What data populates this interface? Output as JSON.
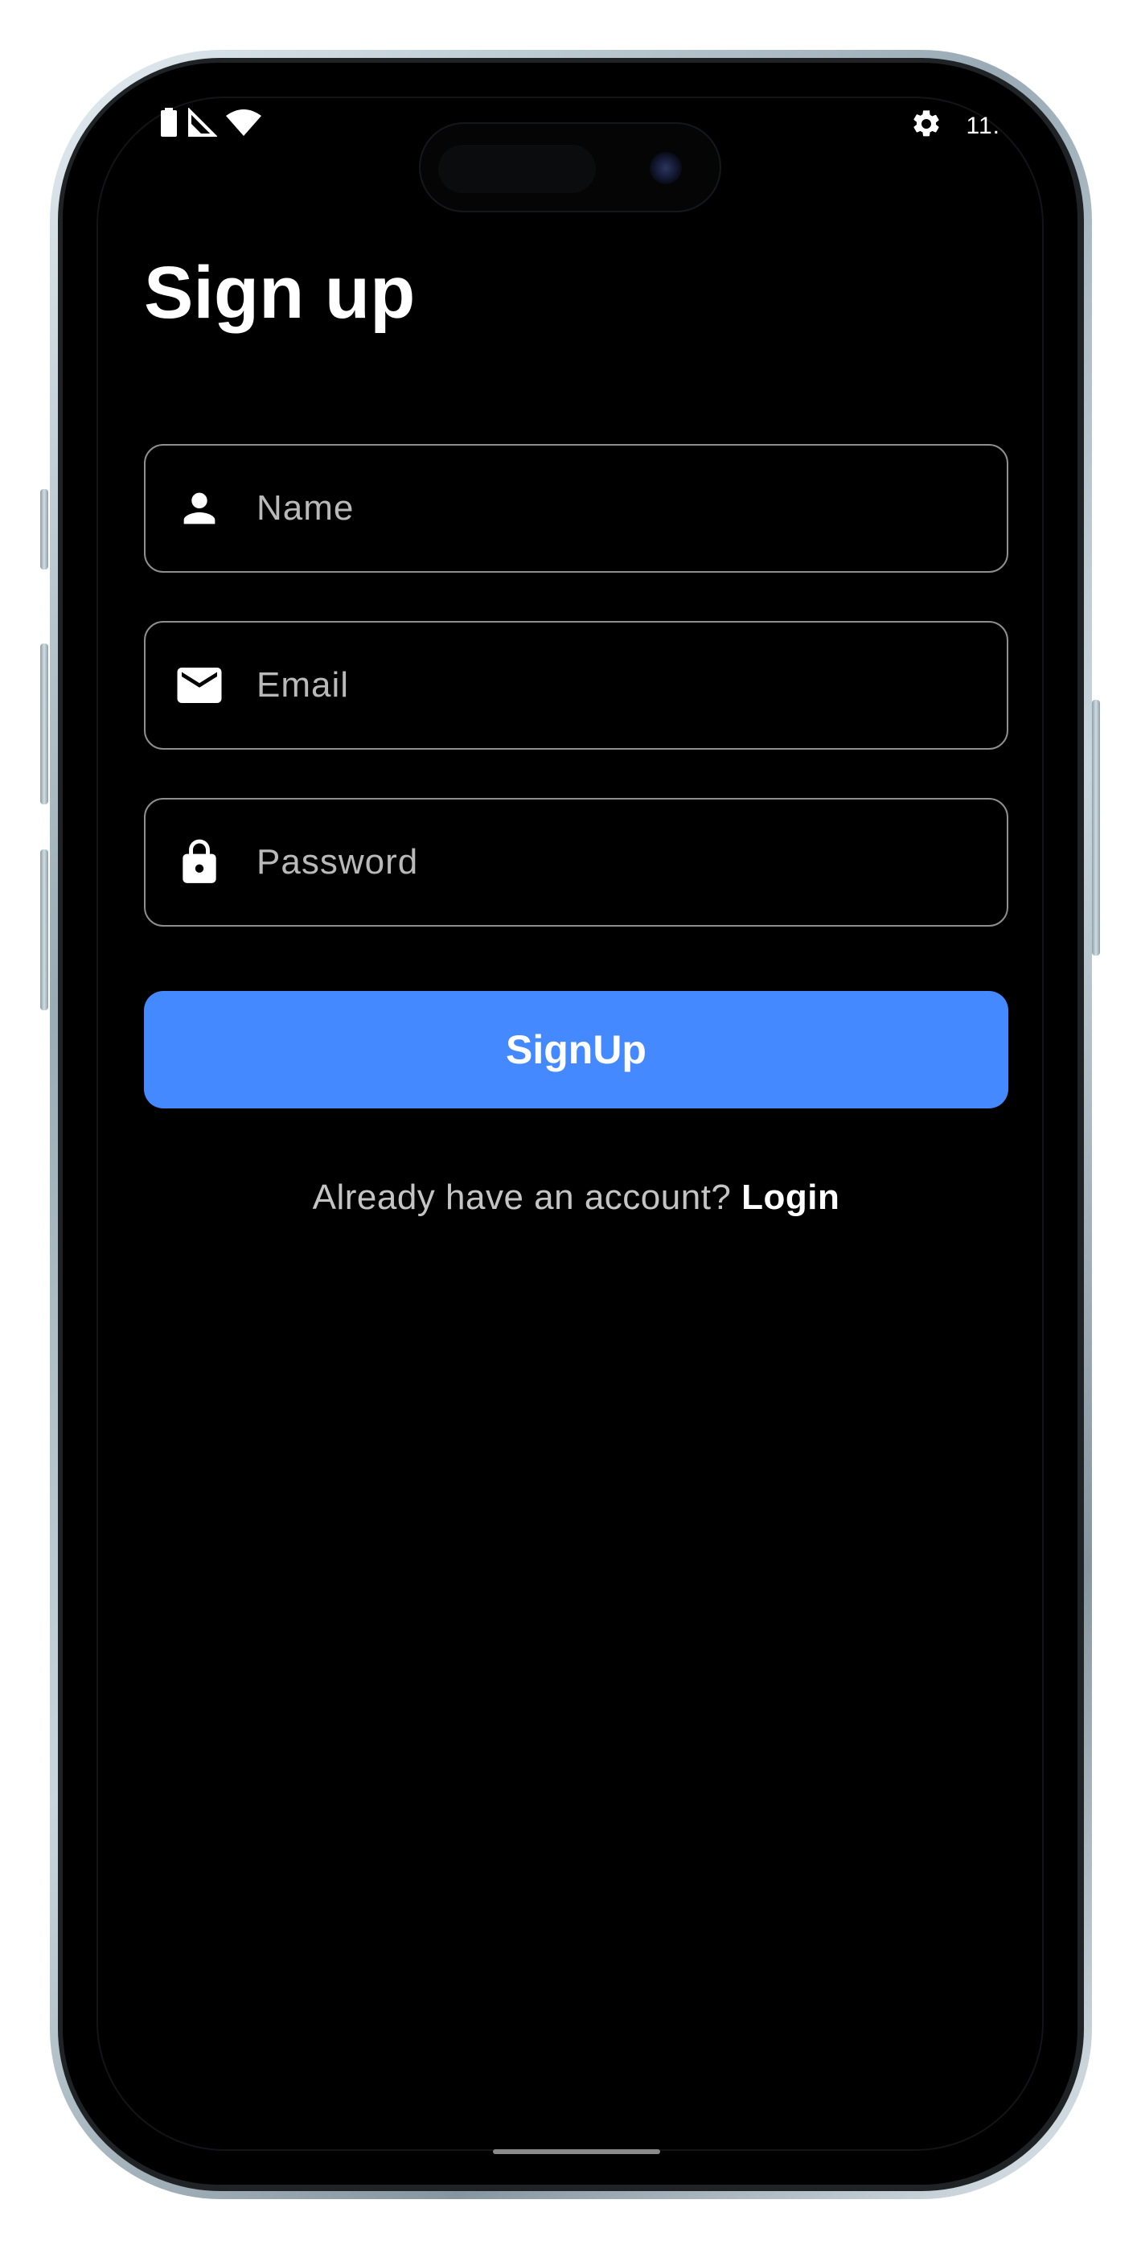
{
  "status_bar": {
    "left_icons": [
      "battery-icon",
      "signal-icon",
      "wifi-icon"
    ],
    "right_icons": [
      "gear-icon"
    ],
    "time_fragment": "11."
  },
  "page": {
    "title": "Sign up"
  },
  "form": {
    "name": {
      "placeholder": "Name",
      "icon": "person-icon"
    },
    "email": {
      "placeholder": "Email",
      "icon": "mail-icon"
    },
    "password": {
      "placeholder": "Password",
      "icon": "lock-icon"
    }
  },
  "actions": {
    "signup_label": "SignUp",
    "login_prompt": "Already have an account? ",
    "login_link": "Login"
  },
  "colors": {
    "background": "#000000",
    "accent": "#4489ff",
    "field_border": "#8e8e8e",
    "placeholder": "#b9b9b9"
  }
}
